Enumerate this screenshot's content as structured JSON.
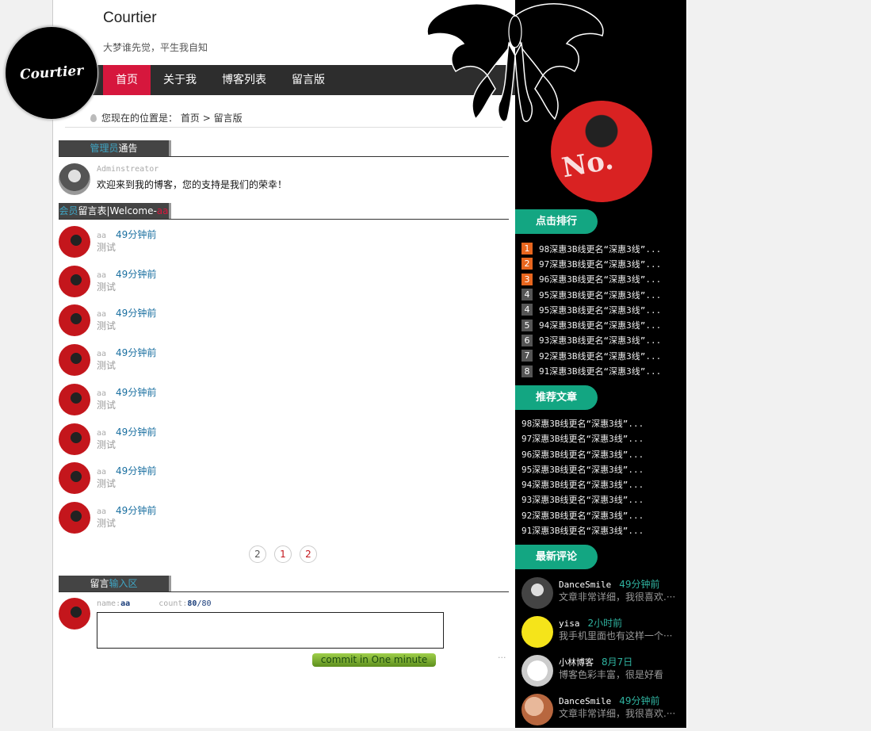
{
  "header": {
    "logo_text": "Courtier",
    "site_title": "Courtier",
    "site_subtitle": "大梦谁先觉，平生我自知"
  },
  "nav": {
    "items": [
      {
        "label": "首页",
        "active": true
      },
      {
        "label": "关于我"
      },
      {
        "label": "博客列表"
      },
      {
        "label": "留言版"
      }
    ]
  },
  "breadcrumb": {
    "prefix": "您现在的位置是：",
    "home": "首页",
    "separator": ">",
    "current": "留言版"
  },
  "admin_section": {
    "title_hl": "管理员",
    "title_rest": "通告",
    "author": "Adminstreator",
    "message": "欢迎来到我的博客，您的支持是我们的荣幸！"
  },
  "member_section": {
    "title_hl": "会员",
    "title_rest": "留言表|Welcome-",
    "title_user": "aa"
  },
  "messages": [
    {
      "user": "aa",
      "time": "49分钟前",
      "text": "测试"
    },
    {
      "user": "aa",
      "time": "49分钟前",
      "text": "测试"
    },
    {
      "user": "aa",
      "time": "49分钟前",
      "text": "测试"
    },
    {
      "user": "aa",
      "time": "49分钟前",
      "text": "测试"
    },
    {
      "user": "aa",
      "time": "49分钟前",
      "text": "测试"
    },
    {
      "user": "aa",
      "time": "49分钟前",
      "text": "测试"
    },
    {
      "user": "aa",
      "time": "49分钟前",
      "text": "测试"
    },
    {
      "user": "aa",
      "time": "49分钟前",
      "text": "测试"
    }
  ],
  "pager": [
    "2",
    "1",
    "2"
  ],
  "input_section": {
    "title_rest": "留言",
    "title_hl": "输入区",
    "name_label": "name:",
    "name_value": "aa",
    "count_label": "count:",
    "count_value": "80",
    "count_max": "/80",
    "submit_label": "commit in One minute",
    "dots": "···"
  },
  "sidebar": {
    "rank_title": "点击排行",
    "rank": [
      {
        "num": "1",
        "text": "98深惠3B线更名“深惠3线”..."
      },
      {
        "num": "2",
        "text": "97深惠3B线更名“深惠3线”..."
      },
      {
        "num": "3",
        "text": "96深惠3B线更名“深惠3线”..."
      },
      {
        "num": "4",
        "text": "95深惠3B线更名“深惠3线”..."
      },
      {
        "num": "4",
        "text": "95深惠3B线更名“深惠3线”..."
      },
      {
        "num": "5",
        "text": "94深惠3B线更名“深惠3线”..."
      },
      {
        "num": "6",
        "text": "93深惠3B线更名“深惠3线”..."
      },
      {
        "num": "7",
        "text": "92深惠3B线更名“深惠3线”..."
      },
      {
        "num": "8",
        "text": "91深惠3B线更名“深惠3线”..."
      }
    ],
    "rec_title": "推荐文章",
    "recommended": [
      "98深惠3B线更名“深惠3线”...",
      "97深惠3B线更名“深惠3线”...",
      "96深惠3B线更名“深惠3线”...",
      "95深惠3B线更名“深惠3线”...",
      "94深惠3B线更名“深惠3线”...",
      "93深惠3B线更名“深惠3线”...",
      "92深惠3B线更名“深惠3线”...",
      "91深惠3B线更名“深惠3线”..."
    ],
    "comment_title": "最新评论",
    "comments": [
      {
        "name": "DanceSmile",
        "time": "49分钟前",
        "text": "文章非常详细，我很喜欢.···"
      },
      {
        "name": "yisa",
        "time": "2小时前",
        "text": "我手机里面也有这样一个···"
      },
      {
        "name": "小林博客",
        "time": "8月7日",
        "text": "博客色彩丰富，很是好看"
      },
      {
        "name": "DanceSmile",
        "time": "49分钟前",
        "text": "文章非常详细，我很喜欢.···"
      }
    ]
  },
  "colors": {
    "accent_red": "#d6173d",
    "sidebar_green": "#13a682",
    "rank_orange": "#e8661e"
  }
}
